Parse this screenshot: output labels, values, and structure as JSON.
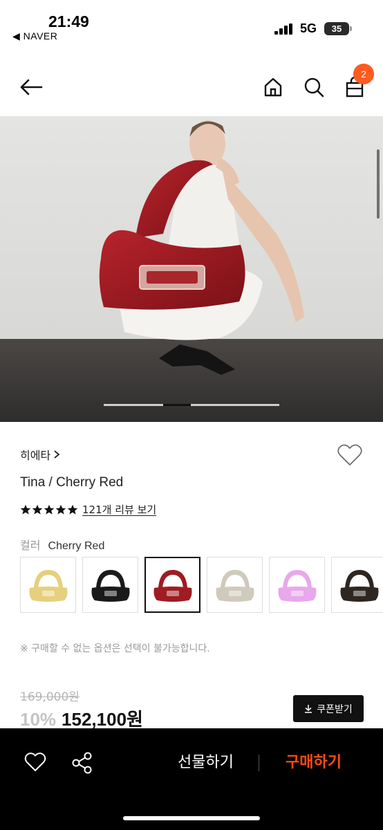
{
  "status_bar": {
    "time": "21:49",
    "back_app": "◀ NAVER",
    "network": "5G",
    "battery": "35"
  },
  "nav": {
    "cart_count": "2",
    "icons": [
      "back-arrow-icon",
      "home-icon",
      "search-icon",
      "shopping-bag-icon"
    ]
  },
  "hero": {
    "slide_progress": 0.34
  },
  "product": {
    "brand": "히에타",
    "title": "Tina / Cherry Red",
    "rating_stars": 5,
    "review_link": "121개 리뷰 보기",
    "color_label": "컬러",
    "color_value": "Cherry Red",
    "swatches": [
      {
        "color": "#e6cf7d",
        "selected": false
      },
      {
        "color": "#1a1a1a",
        "selected": false
      },
      {
        "color": "#9e1c22",
        "selected": true
      },
      {
        "color": "#cfcabb",
        "selected": false
      },
      {
        "color": "#e8a8ec",
        "selected": false
      },
      {
        "color": "#2e2620",
        "selected": false
      }
    ],
    "notice": "※ 구매할 수 없는 옵션은 선택이 불가능합니다.",
    "original_price": "169,000원",
    "discount": "10%",
    "price": "152,100원",
    "coupon_label": "쿠폰받기"
  },
  "bottom_bar": {
    "gift_label": "선물하기",
    "buy_label": "구매하기",
    "buy_color": "#ff4b12"
  }
}
